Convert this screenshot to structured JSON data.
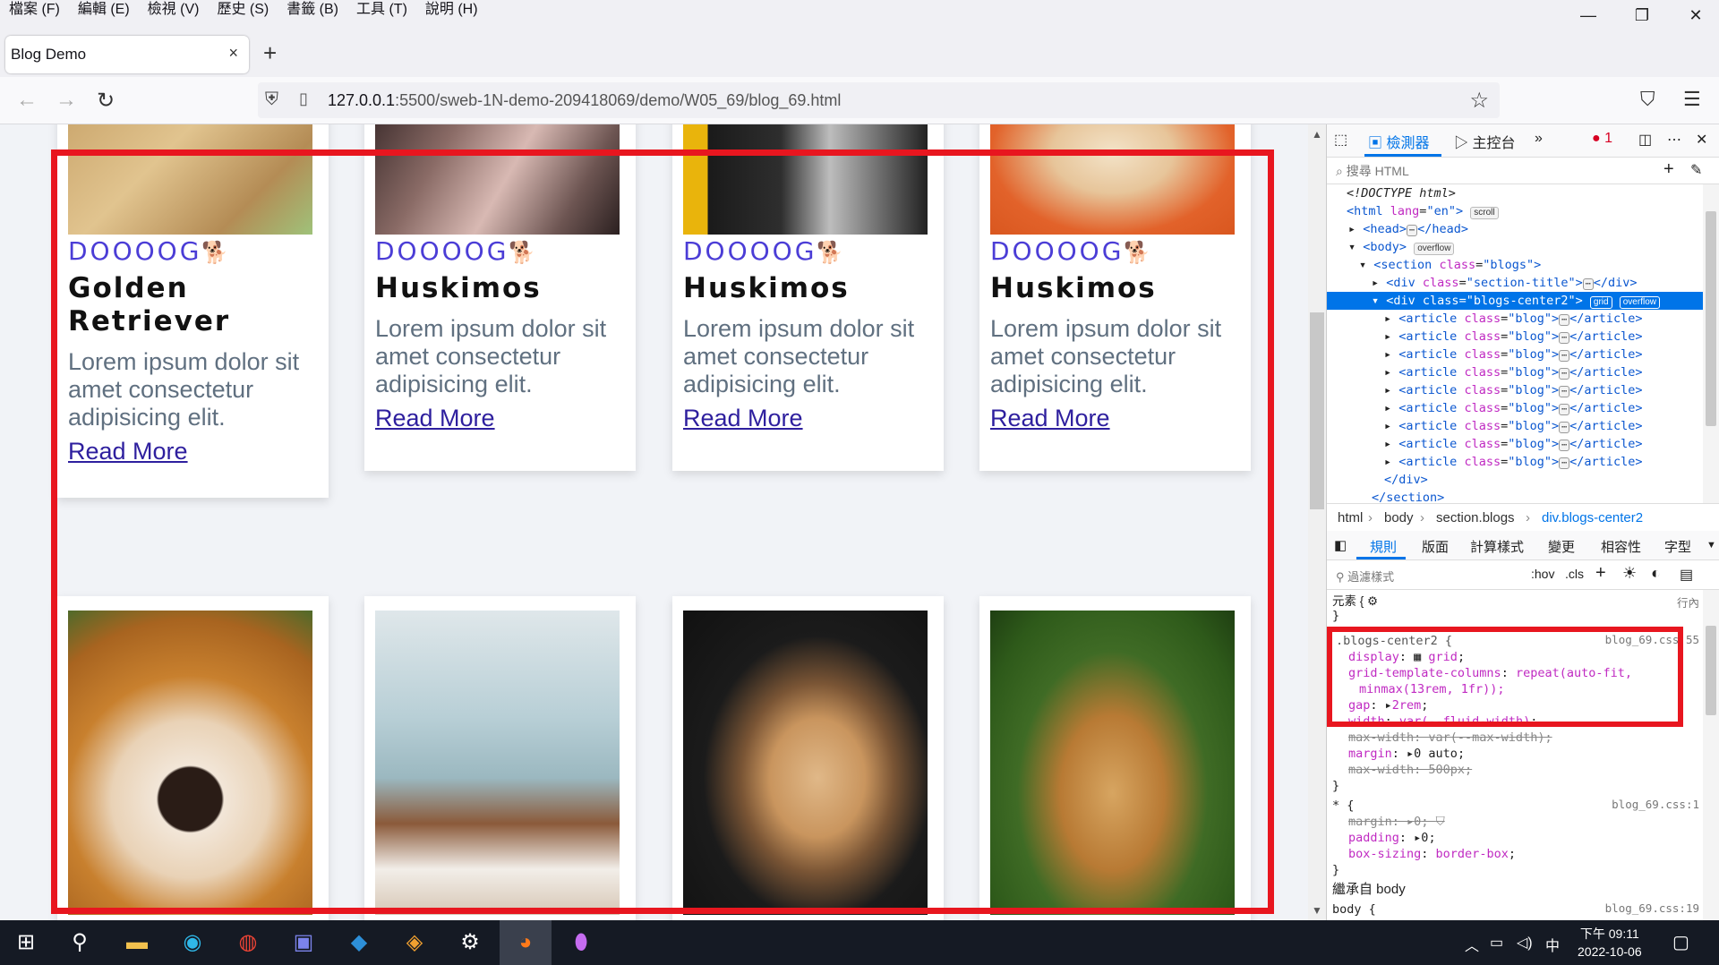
{
  "menubar": {
    "items": [
      "檔案 (F)",
      "編輯 (E)",
      "檢視 (V)",
      "歷史 (S)",
      "書籤 (B)",
      "工具 (T)",
      "說明 (H)"
    ],
    "minimize": "—",
    "maximize": "❐",
    "close": "✕"
  },
  "tab": {
    "title": "Blog Demo",
    "close": "×"
  },
  "newtab": "+",
  "nav": {
    "back": "←",
    "forward": "→",
    "reload": "↻",
    "url_host": "127.0.0.1",
    "url_rest": ":5500/sweb-1N-demo-209418069/demo/W05_69/blog_69.html",
    "star": "☆",
    "pocket": "⛉",
    "menu": "☰"
  },
  "page": {
    "cards_row1": [
      {
        "tag": "DOOOOG",
        "title": "Golden Retriever",
        "desc": "Lorem ipsum dolor sit amet consectetur adipisicing elit.",
        "more": "Read More",
        "img": "golden"
      },
      {
        "tag": "DOOOOG",
        "title": "Huskimos",
        "desc": "Lorem ipsum dolor sit amet consectetur adipisicing elit.",
        "more": "Read More",
        "img": "fur"
      },
      {
        "tag": "DOOOOG",
        "title": "Huskimos",
        "desc": "Lorem ipsum dolor sit amet consectetur adipisicing elit.",
        "more": "Read More",
        "img": "scarf"
      },
      {
        "tag": "DOOOOG",
        "title": "Huskimos",
        "desc": "Lorem ipsum dolor sit amet consectetur adipisicing elit.",
        "more": "Read More",
        "img": "orange"
      }
    ],
    "dog_glyph": "🐕"
  },
  "devtools": {
    "inspector": "檢測器",
    "console": "主控台",
    "errors": "1",
    "search_placeholder": "搜尋 HTML",
    "tree": {
      "doctype": "<!DOCTYPE html>",
      "html_open": "<html",
      "html_attr": "lang",
      "html_val": "\"en\"",
      "scroll_badge": "scroll",
      "overflow_badge": "overflow",
      "grid_badge": "grid",
      "head": "<head>",
      "head_close": "</head>",
      "body": "<body>",
      "section_open": "<section",
      "section_cls": "\"blogs\"",
      "div_open": "<div",
      "section_title_cls": "\"section-title\"",
      "div_close": "</div>",
      "blogs_center_cls": "\"blogs-center2\"",
      "article_open": "<article",
      "article_cls": "\"blog\"",
      "article_close": "</article>",
      "section_close": "</section>",
      "class_attr": "class"
    },
    "breadcrumb": [
      "html",
      "body",
      "section.blogs",
      "div.blogs-center2"
    ],
    "tabs": [
      "規則",
      "版面",
      "計算樣式",
      "變更",
      "相容性",
      "字型"
    ],
    "filter_placeholder": "過濾樣式",
    "hov": ":hov",
    "cls": ".cls",
    "rules": {
      "element": "元素 {",
      "inline": "行內",
      "close": "}",
      "sel1": ".blogs-center2 {",
      "src1": "blog_69.css:55",
      "display": "display",
      "display_val": "grid",
      "gtc": "grid-template-columns",
      "gtc_val1": "repeat(auto-fit,",
      "gtc_val2": "minmax(13rem, 1fr));",
      "gap": "gap",
      "gap_val": "2rem",
      "width": "width",
      "width_val": "var(--fluid-width)",
      "maxw": "max-width: var(--max-width);",
      "margin": "margin",
      "margin_val": "0 auto",
      "maxw2": "max-width: 500px;",
      "sel2": "* {",
      "src2": "blog_69.css:1",
      "margin2": "margin",
      "margin2_val": "0",
      "padding": "padding",
      "padding_val": "0",
      "boxsizing": "box-sizing",
      "boxsizing_val": "border-box",
      "inherited": "繼承自 body",
      "sel3": "body {",
      "src3": "blog_69.css:19"
    }
  },
  "taskbar": {
    "time": "下午 09:11",
    "date": "2022-10-06",
    "ime": "中"
  }
}
